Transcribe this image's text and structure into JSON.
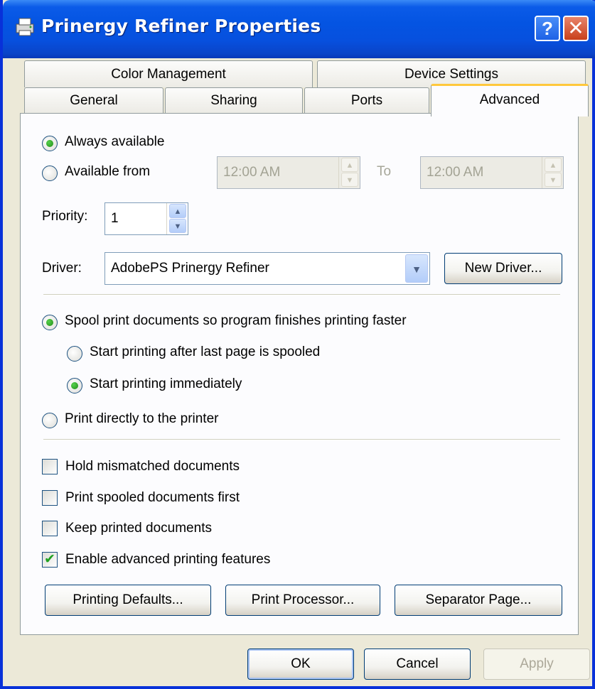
{
  "window": {
    "title": "Prinergy Refiner Properties",
    "help_label": "?",
    "close_label": "✕",
    "printer_icon": "printer-icon"
  },
  "tabs": {
    "row1": [
      "Color Management",
      "Device Settings"
    ],
    "row2": [
      "General",
      "Sharing",
      "Ports",
      "Advanced"
    ],
    "active": "Advanced"
  },
  "availability": {
    "always_label": "Always available",
    "always_selected": true,
    "from_label": "Available from",
    "from_selected": false,
    "from_time": "12:00 AM",
    "to_label": "To",
    "to_time": "12:00 AM"
  },
  "priority": {
    "label": "Priority:",
    "value": "1"
  },
  "driver": {
    "label": "Driver:",
    "value": "AdobePS Prinergy Refiner",
    "new_driver_label": "New Driver..."
  },
  "spool": {
    "spool_label": "Spool print documents so program finishes printing faster",
    "spool_selected": true,
    "after_last_label": "Start printing after last page is spooled",
    "after_last_selected": false,
    "immediately_label": "Start printing immediately",
    "immediately_selected": true,
    "direct_label": "Print directly to the printer",
    "direct_selected": false
  },
  "options": [
    {
      "label": "Hold mismatched documents",
      "checked": false
    },
    {
      "label": "Print spooled documents first",
      "checked": false
    },
    {
      "label": "Keep printed documents",
      "checked": false
    },
    {
      "label": "Enable advanced printing features",
      "checked": true
    }
  ],
  "buttons": {
    "printing_defaults": "Printing Defaults...",
    "print_processor": "Print Processor...",
    "separator_page": "Separator Page...",
    "ok": "OK",
    "cancel": "Cancel",
    "apply": "Apply"
  },
  "colors": {
    "titlebar": "#0454e2",
    "window_bg": "#ece9d8",
    "active_tab_accent": "#ffc83c",
    "radio_dot": "#218b17"
  }
}
